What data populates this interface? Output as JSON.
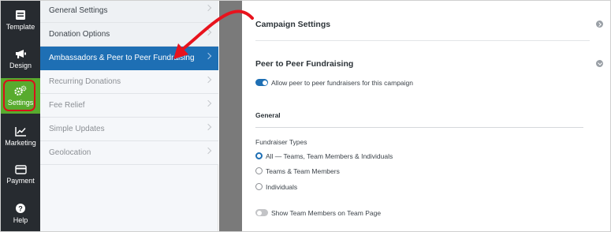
{
  "rail": {
    "items": [
      {
        "label": "Template",
        "icon": "template-icon"
      },
      {
        "label": "Design",
        "icon": "megaphone-icon"
      },
      {
        "label": "Settings",
        "icon": "gears-icon",
        "active": true
      },
      {
        "label": "Marketing",
        "icon": "chart-icon"
      },
      {
        "label": "Payment",
        "icon": "credit-card-icon"
      },
      {
        "label": "Help",
        "icon": "help-icon"
      }
    ],
    "active_color": "#58ab2e",
    "background": "#272b30"
  },
  "menu": {
    "items": [
      {
        "label": "General Settings"
      },
      {
        "label": "Donation Options"
      },
      {
        "label": "Ambassadors & Peer to Peer Fundraising",
        "active": true
      },
      {
        "label": "Recurring Donations"
      },
      {
        "label": "Fee Relief"
      },
      {
        "label": "Simple Updates"
      },
      {
        "label": "Geolocation"
      }
    ],
    "active_color": "#1e6fb4"
  },
  "main": {
    "campaign_settings_title": "Campaign Settings",
    "peer_title": "Peer to Peer Fundraising",
    "allow_peer_label": "Allow peer to peer fundraisers for this campaign",
    "allow_peer_enabled": true,
    "general_title": "General",
    "fundraiser_types_label": "Fundraiser Types",
    "fundraiser_types": [
      {
        "label": "All — Teams, Team Members & Individuals",
        "checked": true
      },
      {
        "label": "Teams & Team Members",
        "checked": false
      },
      {
        "label": "Individuals",
        "checked": false
      }
    ],
    "show_team_members_label": "Show Team Members on Team Page",
    "show_team_members_enabled": false
  },
  "annotation": {
    "arrow_color": "#e8131d",
    "highlight_color": "#d9111b"
  }
}
